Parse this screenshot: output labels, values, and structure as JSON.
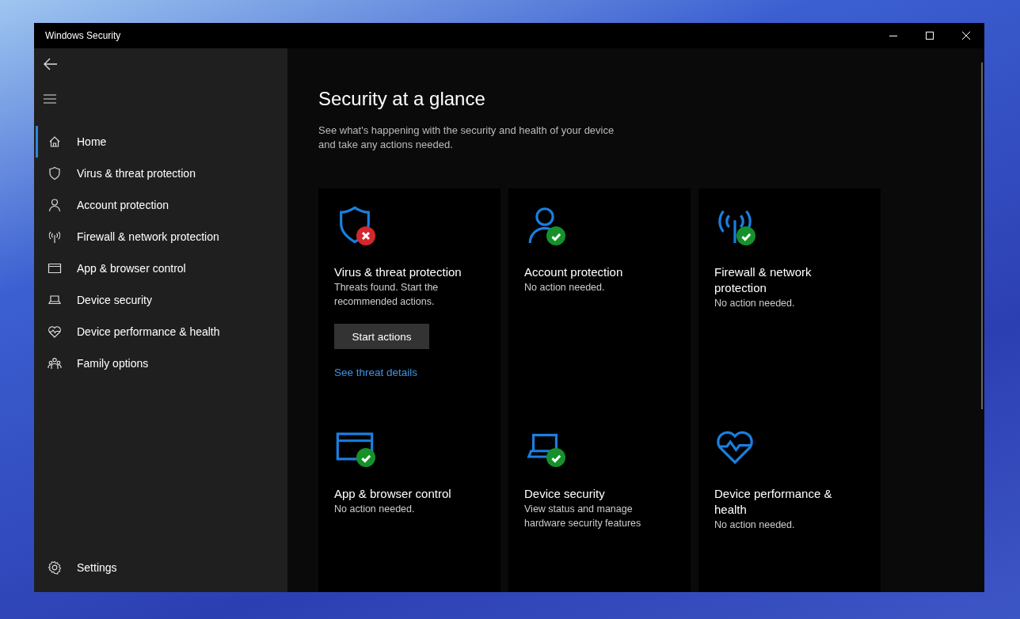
{
  "window": {
    "title": "Windows Security"
  },
  "sidebar": {
    "items": [
      {
        "label": "Home",
        "kind": "home",
        "selected": true
      },
      {
        "label": "Virus & threat protection",
        "kind": "shield",
        "selected": false
      },
      {
        "label": "Account protection",
        "kind": "person",
        "selected": false
      },
      {
        "label": "Firewall & network protection",
        "kind": "antenna",
        "selected": false
      },
      {
        "label": "App & browser control",
        "kind": "browser",
        "selected": false
      },
      {
        "label": "Device security",
        "kind": "laptop",
        "selected": false
      },
      {
        "label": "Device performance & health",
        "kind": "heart",
        "selected": false
      },
      {
        "label": "Family options",
        "kind": "family",
        "selected": false
      }
    ],
    "settings": {
      "label": "Settings"
    }
  },
  "page": {
    "title": "Security at a glance",
    "subtitle": "See what's happening with the security and health of your device and take any actions needed."
  },
  "cards": [
    {
      "kind": "shield",
      "alert": true,
      "checked": false,
      "title": "Virus & threat protection",
      "description": "Threats found. Start the recommended actions.",
      "button": "Start actions",
      "link": "See threat details"
    },
    {
      "kind": "person",
      "alert": false,
      "checked": true,
      "title": "Account protection",
      "description": "No action needed."
    },
    {
      "kind": "antenna",
      "alert": false,
      "checked": true,
      "title": "Firewall & network protection",
      "description": "No action needed."
    },
    {
      "kind": "browser",
      "alert": false,
      "checked": true,
      "title": "App & browser control",
      "description": "No action needed."
    },
    {
      "kind": "laptop",
      "alert": false,
      "checked": true,
      "title": "Device security",
      "description": "View status and manage hardware security features"
    },
    {
      "kind": "heart",
      "alert": false,
      "checked": false,
      "title": "Device performance & health",
      "description": "No action needed."
    }
  ]
}
